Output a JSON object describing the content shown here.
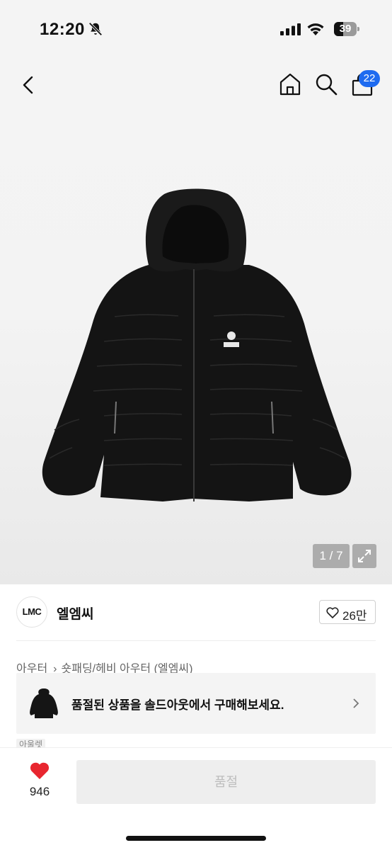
{
  "status_bar": {
    "time": "12:20",
    "battery": "39",
    "icons": [
      "bell-off-icon",
      "signal-icon",
      "wifi-icon",
      "battery-icon"
    ]
  },
  "nav": {
    "cart_badge": "22",
    "icons": [
      "back-icon",
      "home-icon",
      "search-icon",
      "cart-icon"
    ]
  },
  "gallery": {
    "counter": "1 / 7",
    "current_image": 1,
    "total_images": 7
  },
  "brand": {
    "logo_text": "LMC",
    "name": "엘엠씨",
    "likes": "26만"
  },
  "breadcrumb": {
    "category": "아우터",
    "subcategory": "숏패딩/헤비 아우터 (엘엠씨)"
  },
  "soldout_card": {
    "text": "품절된 상품을 솔드아웃에서 구매해보세요."
  },
  "tag_peek": "아울렛",
  "bottom_bar": {
    "wish_count": "946",
    "buy_label": "품절"
  },
  "colors": {
    "badge": "#1e6bf0",
    "heart": "#e8262f",
    "disabled_button": "#eeeeee"
  }
}
